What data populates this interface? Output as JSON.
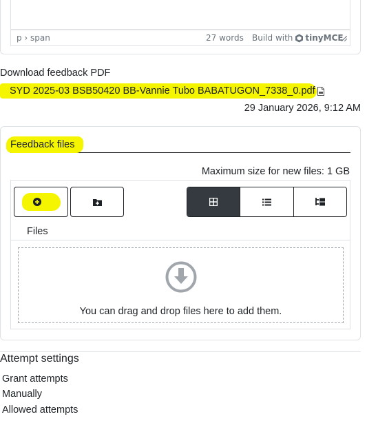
{
  "editor": {
    "path": "p › span",
    "word_count": "27 words",
    "build_with": "Build with",
    "logo_text": "tinyMCE"
  },
  "feedback_pdf": {
    "label": "Download feedback PDF",
    "file_name": "SYD 2025-03 BSB50420 BB-Vannie Tubo BABATUGON_7338_0.pdf",
    "timestamp": "29 January 2026, 9:12 AM"
  },
  "feedback_files": {
    "legend": "Feedback files",
    "max_size": "Maximum size for new files: 1 GB",
    "files_label": "Files",
    "drop_text": "You can drag and drop files here to add them."
  },
  "attempt_settings": {
    "title": "Attempt settings",
    "items": [
      "Grant attempts",
      "Manually",
      "Allowed attempts"
    ]
  },
  "colors": {
    "highlight": "#f5f500",
    "text": "#1d2125",
    "active_view": "#343a40",
    "border": "#dee2e6"
  }
}
